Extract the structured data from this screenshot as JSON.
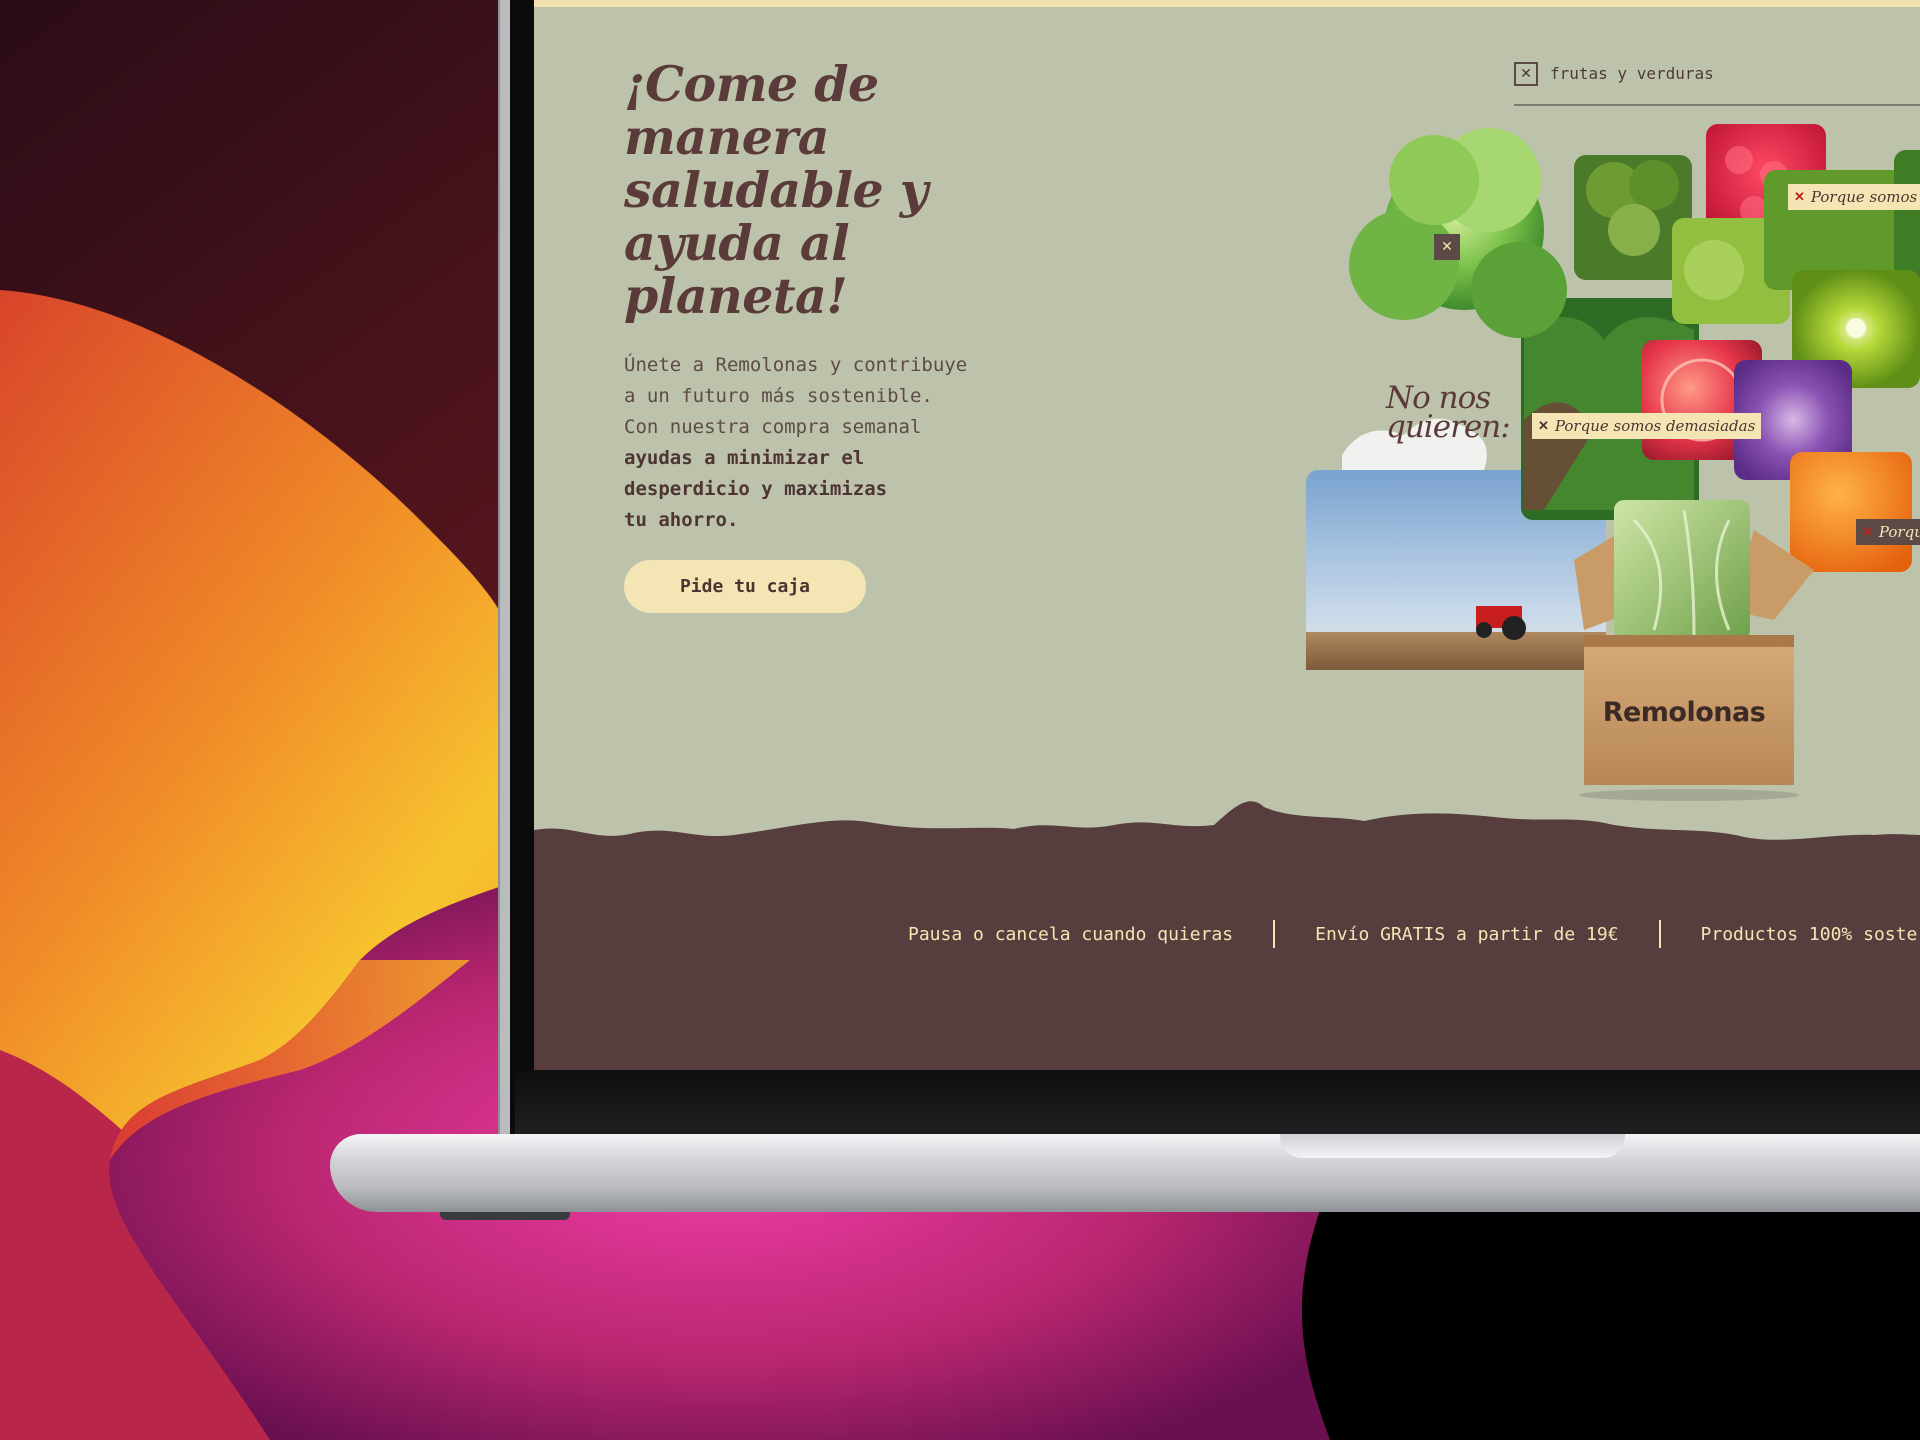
{
  "hero": {
    "title_line1": "¡Come de",
    "title_line2": "manera",
    "title_line3": "saludable y",
    "title_bold1": "ayuda al",
    "title_bold2": "planeta!",
    "text_line1": "Únete a Remolonas y contribuye",
    "text_line2": "a un futuro más sostenible.",
    "text_line3": "Con nuestra compra semanal",
    "text_bold1": "ayudas a minimizar el",
    "text_bold2": "desperdicio y maximizas",
    "text_bold3": "tu ahorro.",
    "cta_label": "Pide tu caja"
  },
  "filter": {
    "close_glyph": "✕",
    "label": "frutas y verduras"
  },
  "collage": {
    "heading_line1": "No nos",
    "heading_line2": "quieren:",
    "tags": [
      {
        "x": "✕",
        "text": "Porque somos pe"
      },
      {
        "x": "✕",
        "text": "Porque somos demasiadas"
      },
      {
        "x": "✕",
        "text": "Porqu"
      }
    ],
    "close_glyph": "✕",
    "box_logo": "Remolonas"
  },
  "benefits": [
    "Pausa o cancela cuando quieras",
    "Envío GRATIS a partir de 19€",
    "Productos 100% soste"
  ],
  "colors": {
    "page_bg": "#bdc3ab",
    "brown": "#573d3e",
    "cream": "#f3e6b4",
    "accent_red": "#b3261e"
  }
}
